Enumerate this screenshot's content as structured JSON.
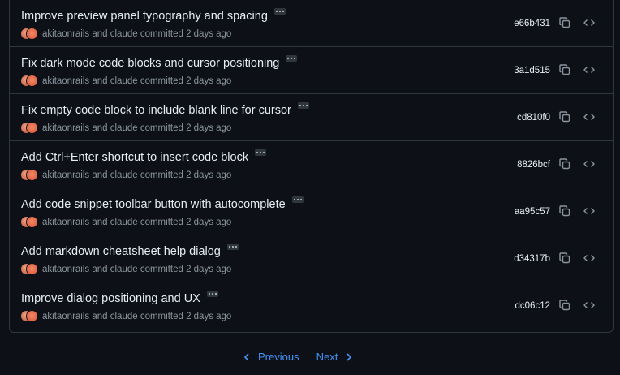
{
  "commits": [
    {
      "title": "Improve preview panel typography and spacing",
      "authors": "akitaonrails and claude committed 2 days ago",
      "sha": "e66b431"
    },
    {
      "title": "Fix dark mode code blocks and cursor positioning",
      "authors": "akitaonrails and claude committed 2 days ago",
      "sha": "3a1d515"
    },
    {
      "title": "Fix empty code block to include blank line for cursor",
      "authors": "akitaonrails and claude committed 2 days ago",
      "sha": "cd810f0"
    },
    {
      "title": "Add Ctrl+Enter shortcut to insert code block",
      "authors": "akitaonrails and claude committed 2 days ago",
      "sha": "8826bcf"
    },
    {
      "title": "Add code snippet toolbar button with autocomplete",
      "authors": "akitaonrails and claude committed 2 days ago",
      "sha": "aa95c57"
    },
    {
      "title": "Add markdown cheatsheet help dialog",
      "authors": "akitaonrails and claude committed 2 days ago",
      "sha": "d34317b"
    },
    {
      "title": "Improve dialog positioning and UX",
      "authors": "akitaonrails and claude committed 2 days ago",
      "sha": "dc06c12"
    }
  ],
  "pagination": {
    "previous": "Previous",
    "next": "Next"
  },
  "icons": {
    "copy": "copy-icon",
    "browse": "code-icon",
    "more": "ellipsis-icon"
  },
  "colors": {
    "background": "#0d1117",
    "border": "#30363d",
    "link": "#4493f8",
    "muted": "#8b949e",
    "text": "#e6edf3"
  }
}
